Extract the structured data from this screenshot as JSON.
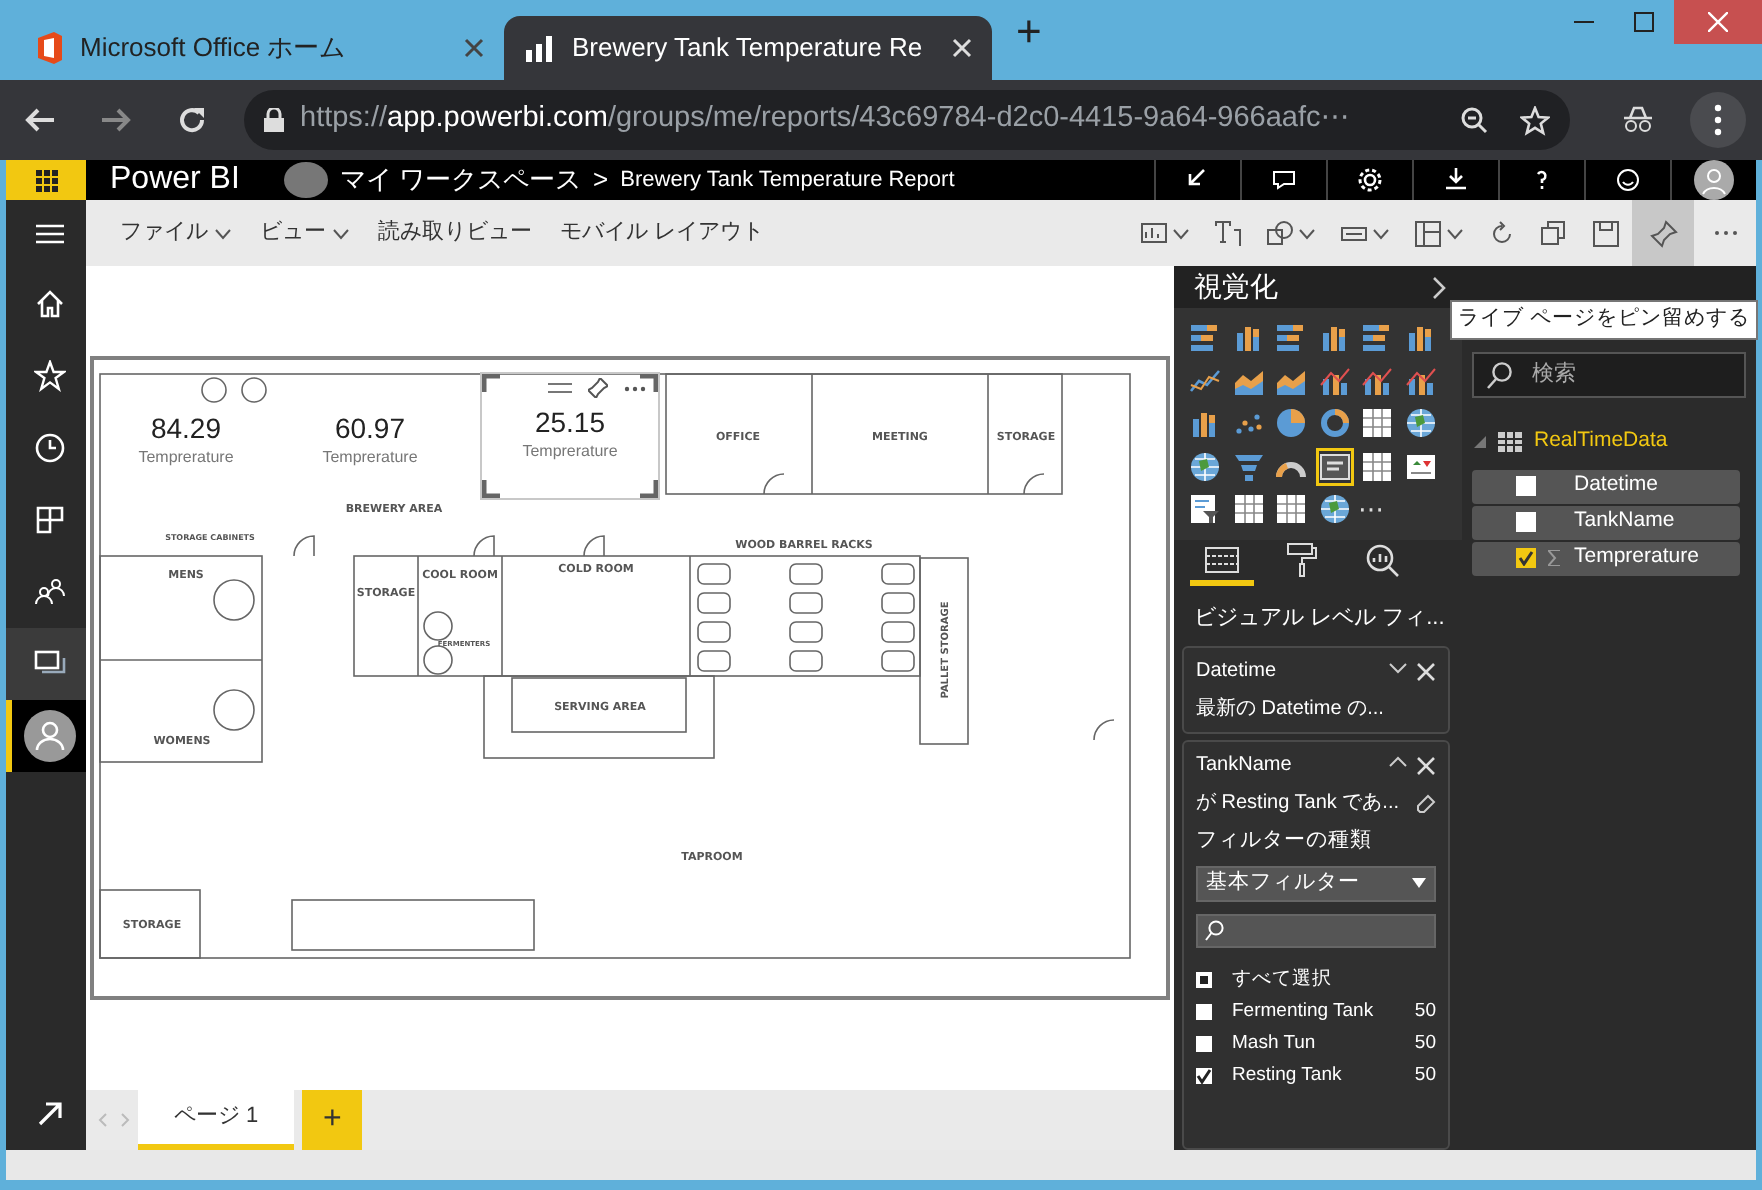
{
  "browser": {
    "tabs": [
      {
        "title": "Microsoft Office ホーム",
        "selected": false
      },
      {
        "title": "Brewery Tank Temperature Re",
        "selected": true
      }
    ],
    "new_tab": "+",
    "url": {
      "scheme": "https://",
      "host": "app.powerbi.com",
      "path": "/groups/me/reports/43c69784-d2c0-4415-9a64-966aafc⋯"
    }
  },
  "header": {
    "app_name": "Power BI",
    "workspace": "マイ ワークスペース",
    "separator": ">",
    "report_title": "Brewery Tank Temperature Report"
  },
  "ribbon": {
    "menus": [
      {
        "label": "ファイル",
        "dropdown": true
      },
      {
        "label": "ビュー",
        "dropdown": true
      },
      {
        "label": "読み取りビュー",
        "dropdown": false
      },
      {
        "label": "モバイル レイアウト",
        "dropdown": false
      }
    ],
    "tools": [
      {
        "kind": "visual",
        "dropdown": true,
        "selected": false
      },
      {
        "kind": "textbox",
        "dropdown": false,
        "selected": false
      },
      {
        "kind": "shapes",
        "dropdown": true,
        "selected": false
      },
      {
        "kind": "buttons",
        "dropdown": true,
        "selected": false
      },
      {
        "kind": "layout",
        "dropdown": true,
        "selected": false
      },
      {
        "kind": "refresh",
        "dropdown": false,
        "selected": false
      },
      {
        "kind": "duplicate",
        "dropdown": false,
        "selected": false
      },
      {
        "kind": "save",
        "dropdown": false,
        "selected": false
      },
      {
        "kind": "pin",
        "dropdown": false,
        "selected": true
      },
      {
        "kind": "more",
        "dropdown": false,
        "selected": false
      }
    ]
  },
  "nav": [
    {
      "kind": "home",
      "selected": false,
      "highlighted": false
    },
    {
      "kind": "favorites",
      "selected": false,
      "highlighted": false
    },
    {
      "kind": "recent",
      "selected": false,
      "highlighted": false
    },
    {
      "kind": "apps",
      "selected": false,
      "highlighted": false
    },
    {
      "kind": "shared",
      "selected": false,
      "highlighted": false
    },
    {
      "kind": "workspaces",
      "selected": false,
      "highlighted": true
    },
    {
      "kind": "account",
      "selected": true,
      "highlighted": false
    }
  ],
  "canvas": {
    "rooms": [
      "OFFICE",
      "MEETING",
      "STORAGE",
      "BREWERY AREA",
      "STORAGE CABINETS",
      "MENS",
      "STORAGE",
      "COOL ROOM",
      "COLD ROOM",
      "WOOD BARREL RACKS",
      "FERMENTERS",
      "PALLET STORAGE",
      "SERVING AREA",
      "WOMENS",
      "TAPROOM",
      "STORAGE"
    ],
    "cards": [
      {
        "value": "84.29",
        "label": "Temprerature",
        "selected": false
      },
      {
        "value": "60.97",
        "label": "Temprerature",
        "selected": false
      },
      {
        "value": "25.15",
        "label": "Temprerature",
        "selected": true
      }
    ]
  },
  "pages": {
    "tabs": [
      {
        "label": "ページ 1",
        "selected": true
      }
    ],
    "add": "+"
  },
  "visualizations": {
    "title": "視覚化",
    "types": [
      {
        "kind": "stacked-bar",
        "selected": false
      },
      {
        "kind": "stacked-column",
        "selected": false
      },
      {
        "kind": "clustered-bar",
        "selected": false
      },
      {
        "kind": "clustered-column",
        "selected": false
      },
      {
        "kind": "percent-bar",
        "selected": false
      },
      {
        "kind": "percent-column",
        "selected": false
      },
      {
        "kind": "line",
        "selected": false
      },
      {
        "kind": "area",
        "selected": false
      },
      {
        "kind": "stacked-area",
        "selected": false
      },
      {
        "kind": "line-column",
        "selected": false
      },
      {
        "kind": "line-clustered-column",
        "selected": false
      },
      {
        "kind": "ribbon",
        "selected": false
      },
      {
        "kind": "waterfall",
        "selected": false
      },
      {
        "kind": "scatter",
        "selected": false
      },
      {
        "kind": "pie",
        "selected": false
      },
      {
        "kind": "donut",
        "selected": false
      },
      {
        "kind": "treemap",
        "selected": false
      },
      {
        "kind": "map",
        "selected": false
      },
      {
        "kind": "filled-map",
        "selected": false
      },
      {
        "kind": "funnel",
        "selected": false
      },
      {
        "kind": "gauge",
        "selected": false
      },
      {
        "kind": "card",
        "selected": true
      },
      {
        "kind": "multi-row-card",
        "selected": false
      },
      {
        "kind": "kpi",
        "selected": false
      },
      {
        "kind": "slicer",
        "selected": false
      },
      {
        "kind": "table",
        "selected": false
      },
      {
        "kind": "matrix",
        "selected": false
      },
      {
        "kind": "arcgis-map",
        "selected": false
      }
    ],
    "more": "⋯",
    "pane_tabs": [
      {
        "kind": "fields",
        "selected": true
      },
      {
        "kind": "format",
        "selected": false
      },
      {
        "kind": "analytics",
        "selected": false
      }
    ],
    "filters": {
      "heading": "ビジュアル レベル フィ...",
      "cards": [
        {
          "field": "Datetime",
          "summary": "最新の Datetime の...",
          "expanded": false
        },
        {
          "field": "TankName",
          "summary": "が Resting Tank であ...",
          "expanded": true,
          "type_label": "フィルターの種類",
          "type_value": "基本フィルター",
          "options": [
            {
              "label": "すべて選択",
              "checked": false,
              "indeterminate": true
            },
            {
              "label": "Fermenting Tank",
              "count": "50",
              "checked": false,
              "indeterminate": false
            },
            {
              "label": "Mash Tun",
              "count": "50",
              "checked": false,
              "indeterminate": false
            },
            {
              "label": "Resting Tank",
              "count": "50",
              "checked": true,
              "indeterminate": false
            }
          ]
        }
      ]
    }
  },
  "fields": {
    "search_placeholder": "検索",
    "tables": [
      {
        "name": "RealTimeData",
        "expanded": true,
        "fields": [
          {
            "name": "Datetime",
            "checked": false,
            "numeric": false
          },
          {
            "name": "TankName",
            "checked": false,
            "numeric": false
          },
          {
            "name": "Temprerature",
            "checked": true,
            "numeric": true
          }
        ]
      }
    ]
  },
  "tooltip": "ライブ ページをピン留めする"
}
